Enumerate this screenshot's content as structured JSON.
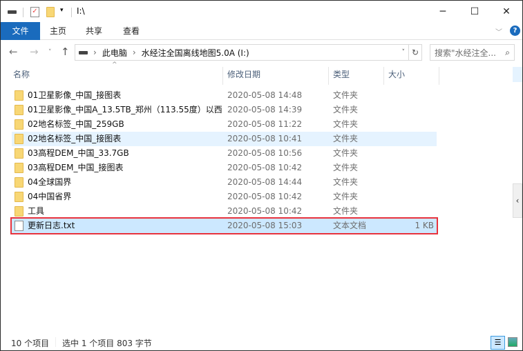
{
  "window": {
    "path_title": "I:\\"
  },
  "ribbon": {
    "tabs": [
      "文件",
      "主页",
      "共享",
      "查看"
    ]
  },
  "address": {
    "crumbs": [
      "此电脑",
      "水经注全国离线地图5.0A (I:)"
    ],
    "search_placeholder": "搜索\"水经注全...",
    "separator": "›"
  },
  "columns": {
    "name": "名称",
    "date": "修改日期",
    "type": "类型",
    "size": "大小"
  },
  "files": [
    {
      "name": "01卫星影像_中国_接图表",
      "date": "2020-05-08 14:48",
      "type": "文件夹",
      "size": "",
      "icon": "folder-icon"
    },
    {
      "name": "01卫星影像_中国A_13.5TB_郑州（113.55度）以西",
      "date": "2020-05-08 14:39",
      "type": "文件夹",
      "size": "",
      "icon": "folder-icon"
    },
    {
      "name": "02地名标签_中国_259GB",
      "date": "2020-05-08 11:22",
      "type": "文件夹",
      "size": "",
      "icon": "folder-icon"
    },
    {
      "name": "02地名标签_中国_接图表",
      "date": "2020-05-08 10:41",
      "type": "文件夹",
      "size": "",
      "icon": "folder-icon"
    },
    {
      "name": "03高程DEM_中国_33.7GB",
      "date": "2020-05-08 10:56",
      "type": "文件夹",
      "size": "",
      "icon": "folder-icon"
    },
    {
      "name": "03高程DEM_中国_接图表",
      "date": "2020-05-08 10:42",
      "type": "文件夹",
      "size": "",
      "icon": "folder-icon"
    },
    {
      "name": "04全球国界",
      "date": "2020-05-08 14:44",
      "type": "文件夹",
      "size": "",
      "icon": "folder-icon"
    },
    {
      "name": "04中国省界",
      "date": "2020-05-08 10:42",
      "type": "文件夹",
      "size": "",
      "icon": "folder-icon"
    },
    {
      "name": "工具",
      "date": "2020-05-08 10:42",
      "type": "文件夹",
      "size": "",
      "icon": "folder-icon"
    },
    {
      "name": "更新日志.txt",
      "date": "2020-05-08 15:03",
      "type": "文本文档",
      "size": "1 KB",
      "icon": "text-file-icon"
    }
  ],
  "status": {
    "count": "10 个项目",
    "selection": "选中 1 个项目  803 字节"
  },
  "colors": {
    "accent": "#1a6bbd",
    "selection": "#cce8ff",
    "highlight_border": "#e8323c"
  }
}
